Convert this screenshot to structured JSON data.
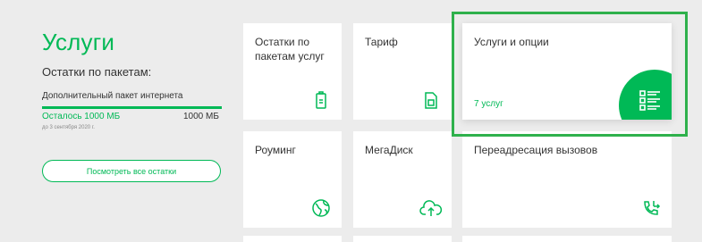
{
  "section": {
    "title": "Услуги",
    "subtitle": "Остатки по пакетам:"
  },
  "package": {
    "name": "Дополнительный пакет интернета",
    "remaining": "Осталось 1000 МБ",
    "total": "1000 МБ",
    "date": "до 3 сентября 2020 г.",
    "progress_fraction": 1.0
  },
  "buttons": {
    "view_all": "Посмотреть все остатки"
  },
  "cards": {
    "balances": "Остатки по пакетам услуг",
    "tariff": "Тариф",
    "services": "Услуги и опции",
    "services_count": "7 услуг",
    "roaming": "Роуминг",
    "megadisk": "МегаДиск",
    "forwarding": "Переадресация вызовов"
  },
  "colors": {
    "accent": "#00b956",
    "highlight": "#2fb14c",
    "background": "#ececec"
  },
  "icons": {
    "balances": "battery-icon",
    "tariff": "sim-card-icon",
    "services": "list-icon",
    "roaming": "globe-icon",
    "megadisk": "cloud-upload-icon",
    "forwarding": "phone-forward-icon"
  }
}
